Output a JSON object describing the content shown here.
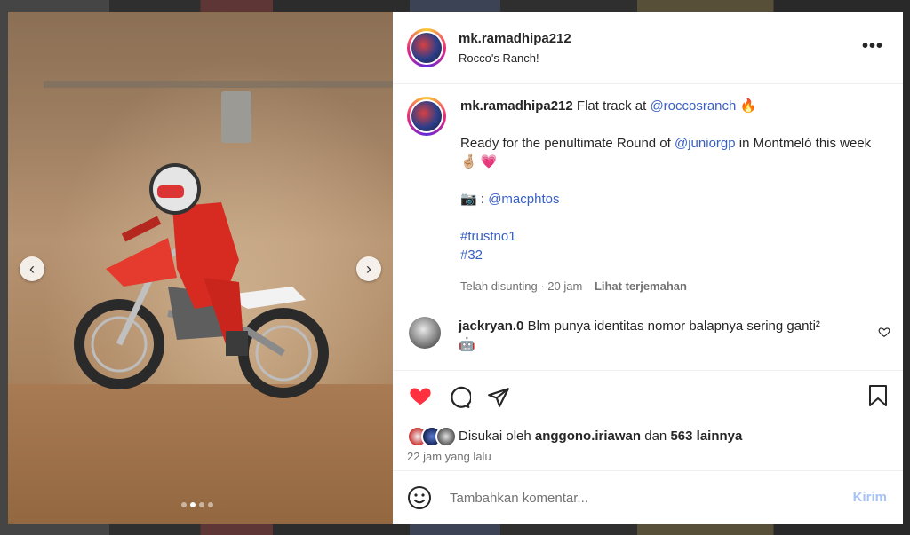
{
  "header": {
    "username": "mk.ramadhipa212",
    "location": "Rocco's Ranch!",
    "more_label": "•••"
  },
  "media": {
    "prev_label": "‹",
    "next_label": "›",
    "slide_count": 4,
    "active_slide": 2
  },
  "caption": {
    "username": "mk.ramadhipa212",
    "text_1": "Flat track at",
    "mention_1": "@roccosranch",
    "emoji_1": "🔥",
    "text_2": "Ready for the penultimate Round of",
    "mention_2": "@juniorgp",
    "text_3": "in Montmeló this week",
    "emoji_2": "🤞🏼 💗",
    "camera": "📷",
    "camera_sep": ":",
    "mention_3": "@macphtos",
    "hashtag_1": "#trustno1",
    "hashtag_2": "#32",
    "edited": "Telah disunting · 20 jam",
    "translate": "Lihat terjemahan"
  },
  "comment": {
    "username": "jackryan.0",
    "text": "Blm punya identitas nomor balapnya sering ganti²",
    "emoji": "🤖"
  },
  "likes": {
    "prefix": "Disukai oleh",
    "user": "anggono.iriawan",
    "conj": "dan",
    "others": "563 lainnya",
    "time": "22 jam yang lalu"
  },
  "add_comment": {
    "placeholder": "Tambahkan komentar...",
    "post_label": "Kirim"
  },
  "colors": {
    "like_red": "#ff3040",
    "link_blue": "#385fc4",
    "post_btn_disabled": "#a7c3f5"
  },
  "icons": [
    "heart-icon",
    "comment-icon",
    "share-icon",
    "bookmark-icon",
    "emoji-icon",
    "more-icon"
  ]
}
